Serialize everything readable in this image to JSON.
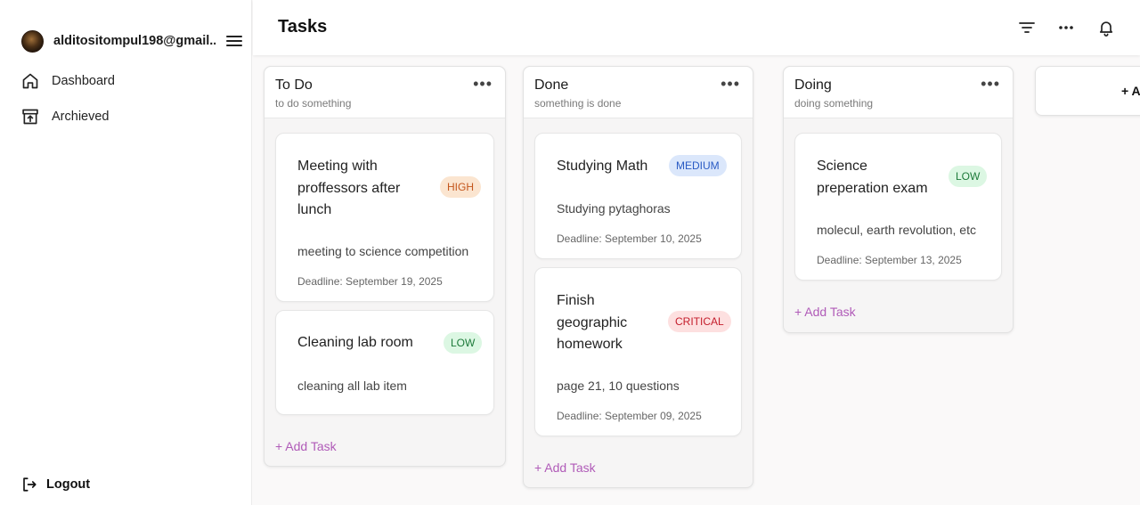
{
  "sidebar": {
    "user_email": "alditositompul198@gmail....",
    "nav": [
      {
        "label": "Dashboard",
        "icon": "home-icon"
      },
      {
        "label": "Archieved",
        "icon": "archive-icon"
      }
    ],
    "logout_label": "Logout"
  },
  "header": {
    "title": "Tasks",
    "icons": [
      "filter-icon",
      "more-icon",
      "bell-icon"
    ]
  },
  "colors": {
    "accent": "#b05bb8",
    "high": "#fbe5d0",
    "high_text": "#c4561c",
    "medium": "#dbe7fb",
    "medium_text": "#2a5bc4",
    "low": "#dcf7e3",
    "low_text": "#1d7a3a",
    "critical": "#fde0e0",
    "critical_text": "#c41d2b"
  },
  "columns": [
    {
      "title": "To Do",
      "subtitle": "to do something",
      "add_label": "+ Add Task",
      "cards": [
        {
          "title": "Meeting with proffessors after lunch",
          "priority": "HIGH",
          "description": "meeting to science competition",
          "deadline": "Deadline: September 19, 2025"
        },
        {
          "title": "Cleaning lab room",
          "priority": "LOW",
          "description": "cleaning all lab item",
          "deadline": ""
        }
      ]
    },
    {
      "title": "Done",
      "subtitle": "something is done",
      "add_label": "+ Add Task",
      "cards": [
        {
          "title": "Studying Math",
          "priority": "MEDIUM",
          "description": "Studying pytaghoras",
          "deadline": "Deadline: September 10, 2025"
        },
        {
          "title": "Finish geographic homework",
          "priority": "CRITICAL",
          "description": "page 21, 10 questions",
          "deadline": "Deadline: September 09, 2025"
        }
      ]
    },
    {
      "title": "Doing",
      "subtitle": "doing something",
      "add_label": "+ Add Task",
      "cards": [
        {
          "title": "Science preperation exam",
          "priority": "LOW",
          "description": "molecul, earth revolution, etc",
          "deadline": "Deadline: September 13, 2025"
        }
      ]
    }
  ],
  "add_column_label": "+ Add"
}
